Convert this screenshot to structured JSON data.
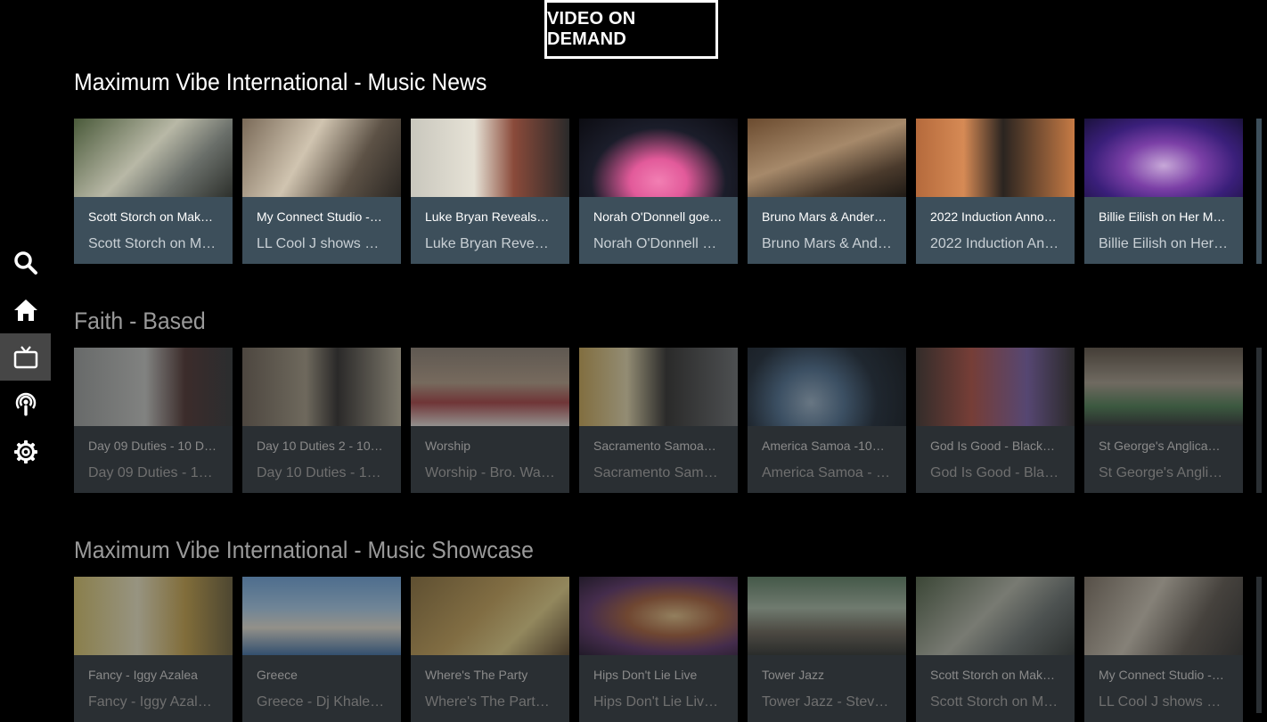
{
  "header": {
    "title": "VIDEO ON DEMAND"
  },
  "nav": [
    {
      "id": "search",
      "icon": "search-icon"
    },
    {
      "id": "home",
      "icon": "home-icon"
    },
    {
      "id": "tv",
      "icon": "tv-icon",
      "active": true
    },
    {
      "id": "podcast",
      "icon": "podcast-icon"
    },
    {
      "id": "settings",
      "icon": "gear-icon"
    }
  ],
  "rows": [
    {
      "title": "Maximum Vibe International - Music News",
      "cards": [
        {
          "title": "Scott Storch on Mak…",
          "subtitle": "Scott Storch on Ma…"
        },
        {
          "title": "My Connect Studio -…",
          "subtitle": "LL Cool J shows hi…"
        },
        {
          "title": "Luke Bryan Reveals…",
          "subtitle": "Luke Bryan Reveal…"
        },
        {
          "title": "Norah O'Donnell goe…",
          "subtitle": "Norah O'Donnell g…"
        },
        {
          "title": "Bruno Mars & Ander…",
          "subtitle": "Bruno Mars & And…"
        },
        {
          "title": "2022 Induction Anno…",
          "subtitle": "2022 Induction An…"
        },
        {
          "title": "Billie Eilish on Her M…",
          "subtitle": "Billie Eilish on Her …"
        }
      ]
    },
    {
      "title": "Faith - Based",
      "cards": [
        {
          "title": "Day 09 Duties - 10 D…",
          "subtitle": "Day 09 Duties - 10 …"
        },
        {
          "title": "Day 10 Duties 2 - 10…",
          "subtitle": "Day 10 Duties - 10 …"
        },
        {
          "title": "Worship",
          "subtitle": "Worship - Bro. Wad…"
        },
        {
          "title": "Sacramento Samoa…",
          "subtitle": "Sacramento Samo…"
        },
        {
          "title": "America Samoa -10…",
          "subtitle": "America Samoa - 1…"
        },
        {
          "title": "God Is Good - Black…",
          "subtitle": "God Is Good - Blac…"
        },
        {
          "title": "St George's Anglica…",
          "subtitle": "St George's Anglic…"
        }
      ]
    },
    {
      "title": "Maximum Vibe International - Music Showcase",
      "cards": [
        {
          "title": "Fancy - Iggy Azalea",
          "subtitle": "Fancy - Iggy Azale…"
        },
        {
          "title": "Greece",
          "subtitle": "Greece - Dj Khaled…"
        },
        {
          "title": "Where's The Party",
          "subtitle": "Where's The Party…"
        },
        {
          "title": "Hips Don't Lie Live",
          "subtitle": "Hips Don't Lie Live…"
        },
        {
          "title": "Tower Jazz",
          "subtitle": "Tower Jazz - Steve…"
        },
        {
          "title": "Scott Storch on Mak…",
          "subtitle": "Scott Storch on Ma…"
        },
        {
          "title": "My Connect Studio -…",
          "subtitle": "LL Cool J shows hi…"
        }
      ]
    }
  ],
  "colors": {
    "card_bg": "#3d4f5b",
    "nav_active": "#464646",
    "background": "#000000"
  }
}
